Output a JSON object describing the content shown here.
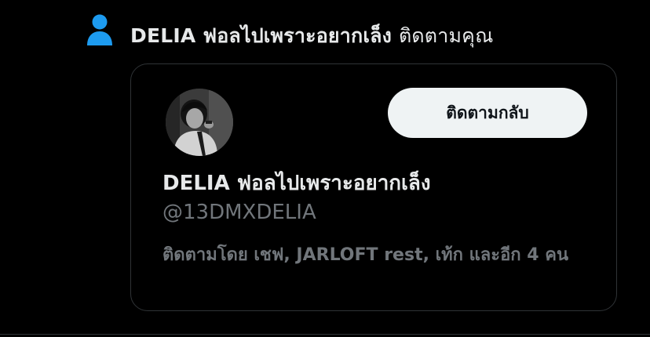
{
  "notification": {
    "icon": "person-icon",
    "actor_name": "DELIA ฟอลไปเพราะอยากเล็ง",
    "action_text": "ติดตามคุณ",
    "accent_color": "#1d9bf0"
  },
  "card": {
    "avatar": "profile-photo",
    "follow_back_label": "ติดตามกลับ",
    "display_name": "DELIA ฟอลไปเพราะอยากเล็ง",
    "handle": "@13DMXDELIA",
    "followed_by": "ติดตามโดย เชฟ, JARLOFT rest, เท้ก และอีก 4 คน"
  }
}
